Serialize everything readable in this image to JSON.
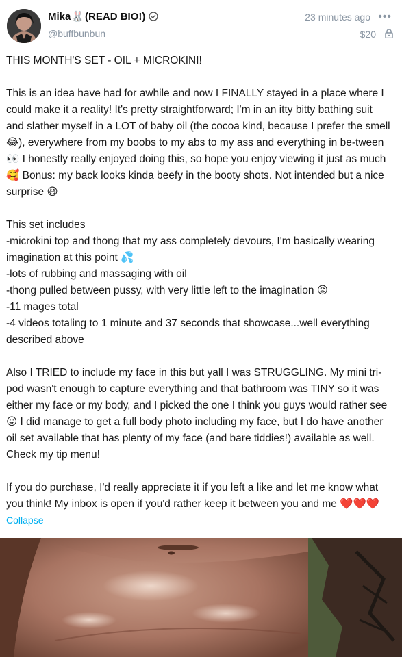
{
  "post": {
    "author": {
      "name_prefix": "Mika",
      "name_emoji": "🐰",
      "name_suffix": "(READ BIO!)",
      "handle": "@buffbunbun"
    },
    "timestamp": "23 minutes ago",
    "more_label": "•••",
    "price": "$20",
    "body": [
      "THIS MONTH'S SET - OIL + MICROKINI!",
      "",
      "This is an idea have had for awhile and now I FINALLY stayed in a place where I could make it a reality! It's pretty straightforward; I'm in an itty bitty bathing suit and slather myself in a LOT of baby oil (the cocoa kind, because I prefer the smell 😂), everywhere from my boobs to my abs to my ass and everything in be-tween 👀 I honestly really enjoyed doing this, so hope you enjoy viewing it just as much 🥰 Bonus: my back looks kinda beefy in the booty shots. Not intended but a nice surprise 😆",
      "",
      "This set includes",
      "-microkini top and thong that my ass completely devours, I'm basically wearing imagination at this point 💦",
      "-lots of rubbing and massaging with oil",
      "-thong pulled between pussy, with very little left to the imagination 😡",
      "-11 mages total",
      "-4 videos totaling to 1 minute and 37 seconds that showcase...well everything described above",
      "",
      "Also I TRIED to include my face in this but yall I was STRUGGLING. My mini tri-pod wasn't enough to capture everything and that bathroom was TINY so it was either my face or my body, and I picked the one I think you guys would rather see 😛 I did manage to get a full body photo including my face, but I do have another oil set available that has plenty of my face (and bare tiddies!) available as well. Check my tip menu!",
      "",
      "If you do purchase, I'd really appreciate it if you left a like and let me know what you think! My inbox is open if you'd rather keep it between you and me ❤️❤️❤️"
    ],
    "collapse_label": "Collapse"
  },
  "colors": {
    "accent": "#00aff0",
    "muted": "#8a96a3",
    "text": "#1a1a1a"
  }
}
